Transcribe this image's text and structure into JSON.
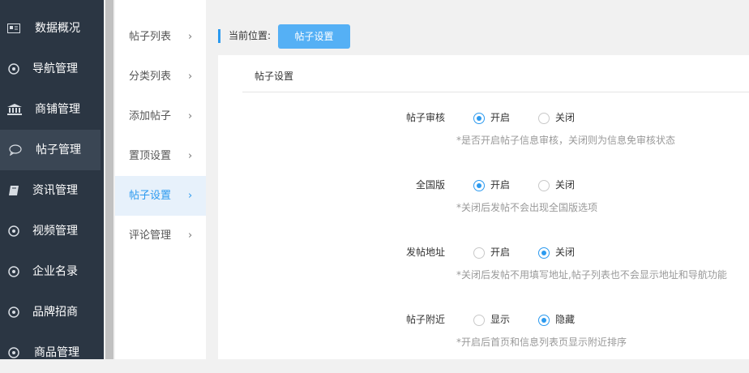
{
  "sidebar": {
    "items": [
      {
        "label": "数据概况",
        "icon": "newspaper-icon"
      },
      {
        "label": "导航管理",
        "icon": "compass-icon"
      },
      {
        "label": "商铺管理",
        "icon": "bank-icon"
      },
      {
        "label": "帖子管理",
        "icon": "speech-bubble-icon"
      },
      {
        "label": "资讯管理",
        "icon": "book-icon"
      },
      {
        "label": "视频管理",
        "icon": "compass-icon"
      },
      {
        "label": "企业名录",
        "icon": "compass-icon"
      },
      {
        "label": "品牌招商",
        "icon": "compass-icon"
      },
      {
        "label": "商品管理",
        "icon": "compass-icon"
      }
    ],
    "active": "帖子管理"
  },
  "subnav": {
    "items": [
      {
        "label": "帖子列表",
        "chevron": "›"
      },
      {
        "label": "分类列表",
        "chevron": "›"
      },
      {
        "label": "添加帖子",
        "chevron": "›"
      },
      {
        "label": "置顶设置",
        "chevron": "›"
      },
      {
        "label": "帖子设置",
        "chevron": "›"
      },
      {
        "label": "评论管理",
        "chevron": "›"
      }
    ],
    "active": "帖子设置"
  },
  "breadcrumb": {
    "label": "当前位置:",
    "current": "帖子设置"
  },
  "panel": {
    "title": "帖子设置",
    "settings": [
      {
        "label": "帖子审核",
        "options": [
          "开启",
          "关闭"
        ],
        "selected": "开启",
        "hint": "*是否开启帖子信息审核，关闭则为信息免审核状态"
      },
      {
        "label": "全国版",
        "options": [
          "开启",
          "关闭"
        ],
        "selected": "开启",
        "hint": "*关闭后发帖不会出现全国版选项"
      },
      {
        "label": "发帖地址",
        "options": [
          "开启",
          "关闭"
        ],
        "selected": "关闭",
        "hint": "*关闭后发帖不用填写地址,帖子列表也不会显示地址和导航功能"
      },
      {
        "label": "帖子附近",
        "options": [
          "显示",
          "隐藏"
        ],
        "selected": "隐藏",
        "hint": "*开启后首页和信息列表页显示附近排序"
      }
    ]
  },
  "colors": {
    "sidebar_bg": "#2b3643",
    "accent": "#2c9aef",
    "button_bg": "#55b0f5"
  }
}
